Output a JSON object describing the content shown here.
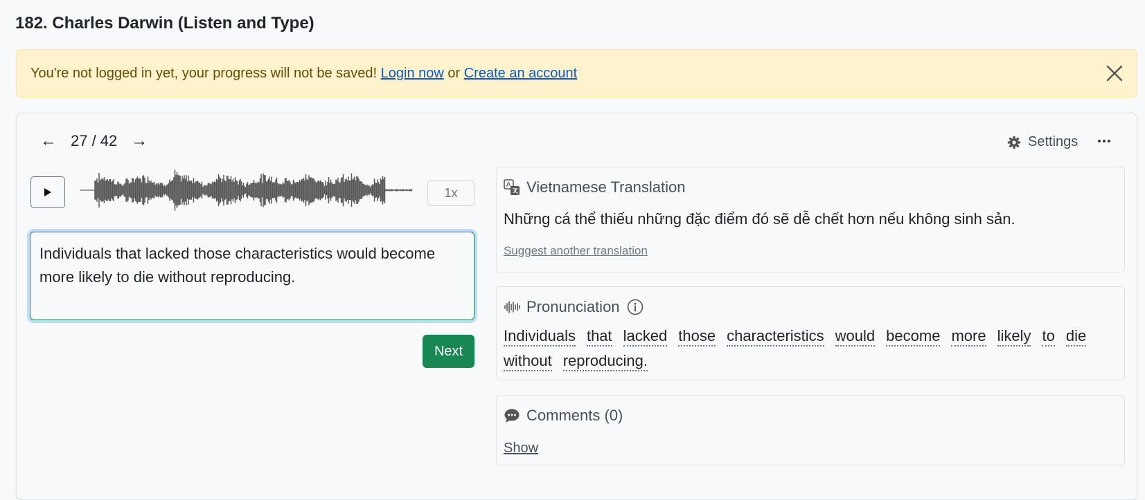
{
  "page": {
    "title": "182. Charles Darwin (Listen and Type)"
  },
  "alert": {
    "message": "You're not logged in yet, your progress will not be saved!",
    "login_link": "Login now",
    "or_text": "or",
    "signup_link": "Create an account",
    "background": "#fff3cd"
  },
  "nav": {
    "prev_icon": "←",
    "counter": "27 / 42",
    "next_icon": "→",
    "settings_label": "Settings",
    "more_icon": "···"
  },
  "player": {
    "play_icon": "play-icon",
    "speed": "1x"
  },
  "answer": {
    "value": "Individuals that lacked those characteristics would become more likely to die without reproducing."
  },
  "next_button": {
    "label": "Next",
    "color": "#198754"
  },
  "translation": {
    "heading": "Vietnamese Translation",
    "text": "Những cá thể thiếu những đặc điểm đó sẽ dễ chết hơn nếu không sinh sản.",
    "suggest_link": "Suggest another translation"
  },
  "pronunciation": {
    "heading": "Pronunciation",
    "words": [
      "Individuals",
      "that",
      "lacked",
      "those",
      "characteristics",
      "would",
      "become",
      "more",
      "likely",
      "to",
      "die",
      "without",
      "reproducing."
    ]
  },
  "comments": {
    "heading": "Comments (0)",
    "show_link": "Show"
  }
}
